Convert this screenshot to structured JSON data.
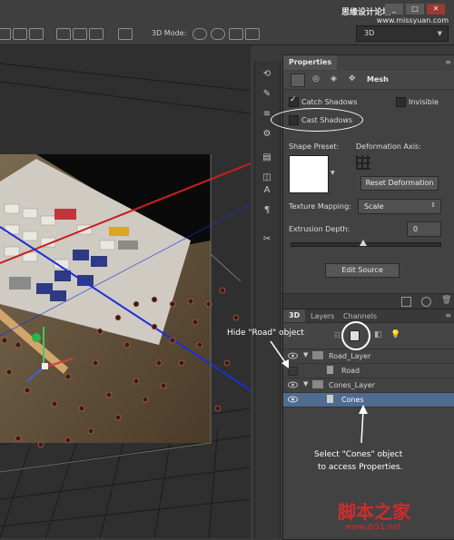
{
  "watermark": {
    "site_cn": "思缘设计论坛",
    "site_url": "www.missyuan.com",
    "bottom_cn": "脚本之家",
    "bottom_url": "www.jb51.net"
  },
  "options_bar": {
    "mode_label": "3D Mode:",
    "workspace_value": "3D"
  },
  "properties": {
    "tab": "Properties",
    "header": "Mesh",
    "catch_shadows": "Catch Shadows",
    "invisible": "Invisible",
    "cast_shadows": "Cast Shadows",
    "shape_preset": "Shape Preset:",
    "deformation_axis": "Deformation Axis:",
    "reset_deformation": "Reset Deformation",
    "texture_mapping": "Texture Mapping:",
    "texture_value": "Scale",
    "extrusion_depth": "Extrusion Depth:",
    "extrusion_value": "0",
    "edit_source": "Edit Source"
  },
  "panel3d": {
    "tabs": [
      "3D",
      "Layers",
      "Channels"
    ],
    "layers": [
      {
        "label": "Road_Layer",
        "indent": 0,
        "eye": true
      },
      {
        "label": "Road",
        "indent": 1,
        "eye": false
      },
      {
        "label": "Cones_Layer",
        "indent": 0,
        "eye": true
      },
      {
        "label": "Cones",
        "indent": 1,
        "eye": true,
        "selected": true
      }
    ]
  },
  "annotations": {
    "hide_road": "Hide \"Road\" object",
    "select_cones_1": "Select \"Cones\" object",
    "select_cones_2": "to access Properties."
  },
  "colors": {
    "accent_selected": "#4f6b8f",
    "red_grid": "#c81e1e",
    "blue_grid": "#1c2ed6"
  }
}
